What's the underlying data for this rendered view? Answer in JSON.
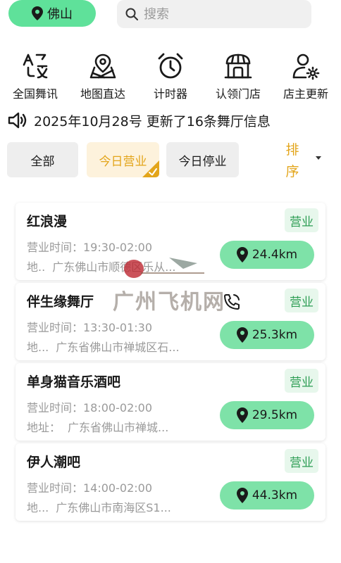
{
  "header": {
    "city": "佛山",
    "search_placeholder": "搜索"
  },
  "quick_nav": [
    {
      "label": "全国舞讯",
      "icon": "translate-icon"
    },
    {
      "label": "地图直达",
      "icon": "map-pin-icon"
    },
    {
      "label": "计时器",
      "icon": "alarm-clock-icon"
    },
    {
      "label": "认领门店",
      "icon": "store-icon"
    },
    {
      "label": "店主更新",
      "icon": "user-settings-icon"
    }
  ],
  "notice": {
    "text": "2025年10月28号 更新了16条舞厅信息"
  },
  "filters": {
    "all": "全部",
    "open_today": "今日营业",
    "closed_today": "今日停业",
    "sort_line1": "排",
    "sort_line2": "序",
    "active": "今日营业"
  },
  "venues": [
    {
      "name": "红浪漫",
      "status": "营业",
      "hours": "营业时间：19:30-02:00",
      "addr_label": "地..",
      "addr_value": "广东佛山市顺德区乐从...",
      "distance": "24.4km"
    },
    {
      "name": "伴生缘舞厅",
      "status": "营业",
      "hours": "营业时间：13:30-01:30",
      "addr_label": "地...",
      "addr_value": "广东省佛山市禅城区石...",
      "distance": "25.3km"
    },
    {
      "name": "单身猫音乐酒吧",
      "status": "营业",
      "hours": "营业时间：18:00-02:00",
      "addr_label": "地址：",
      "addr_value": "广东省佛山市禅城...",
      "distance": "29.5km"
    },
    {
      "name": "伊人潮吧",
      "status": "营业",
      "hours": "营业时间：14:00-02:00",
      "addr_label": "地...",
      "addr_value": "广东佛山市南海区S1...",
      "distance": "44.3km"
    }
  ],
  "watermark": {
    "text": "广州飞机网"
  },
  "colors": {
    "accent_green": "#5fe19a",
    "distance_green": "#7ee2a8",
    "status_green": "#2e9e55",
    "active_orange": "#e3a51a"
  }
}
